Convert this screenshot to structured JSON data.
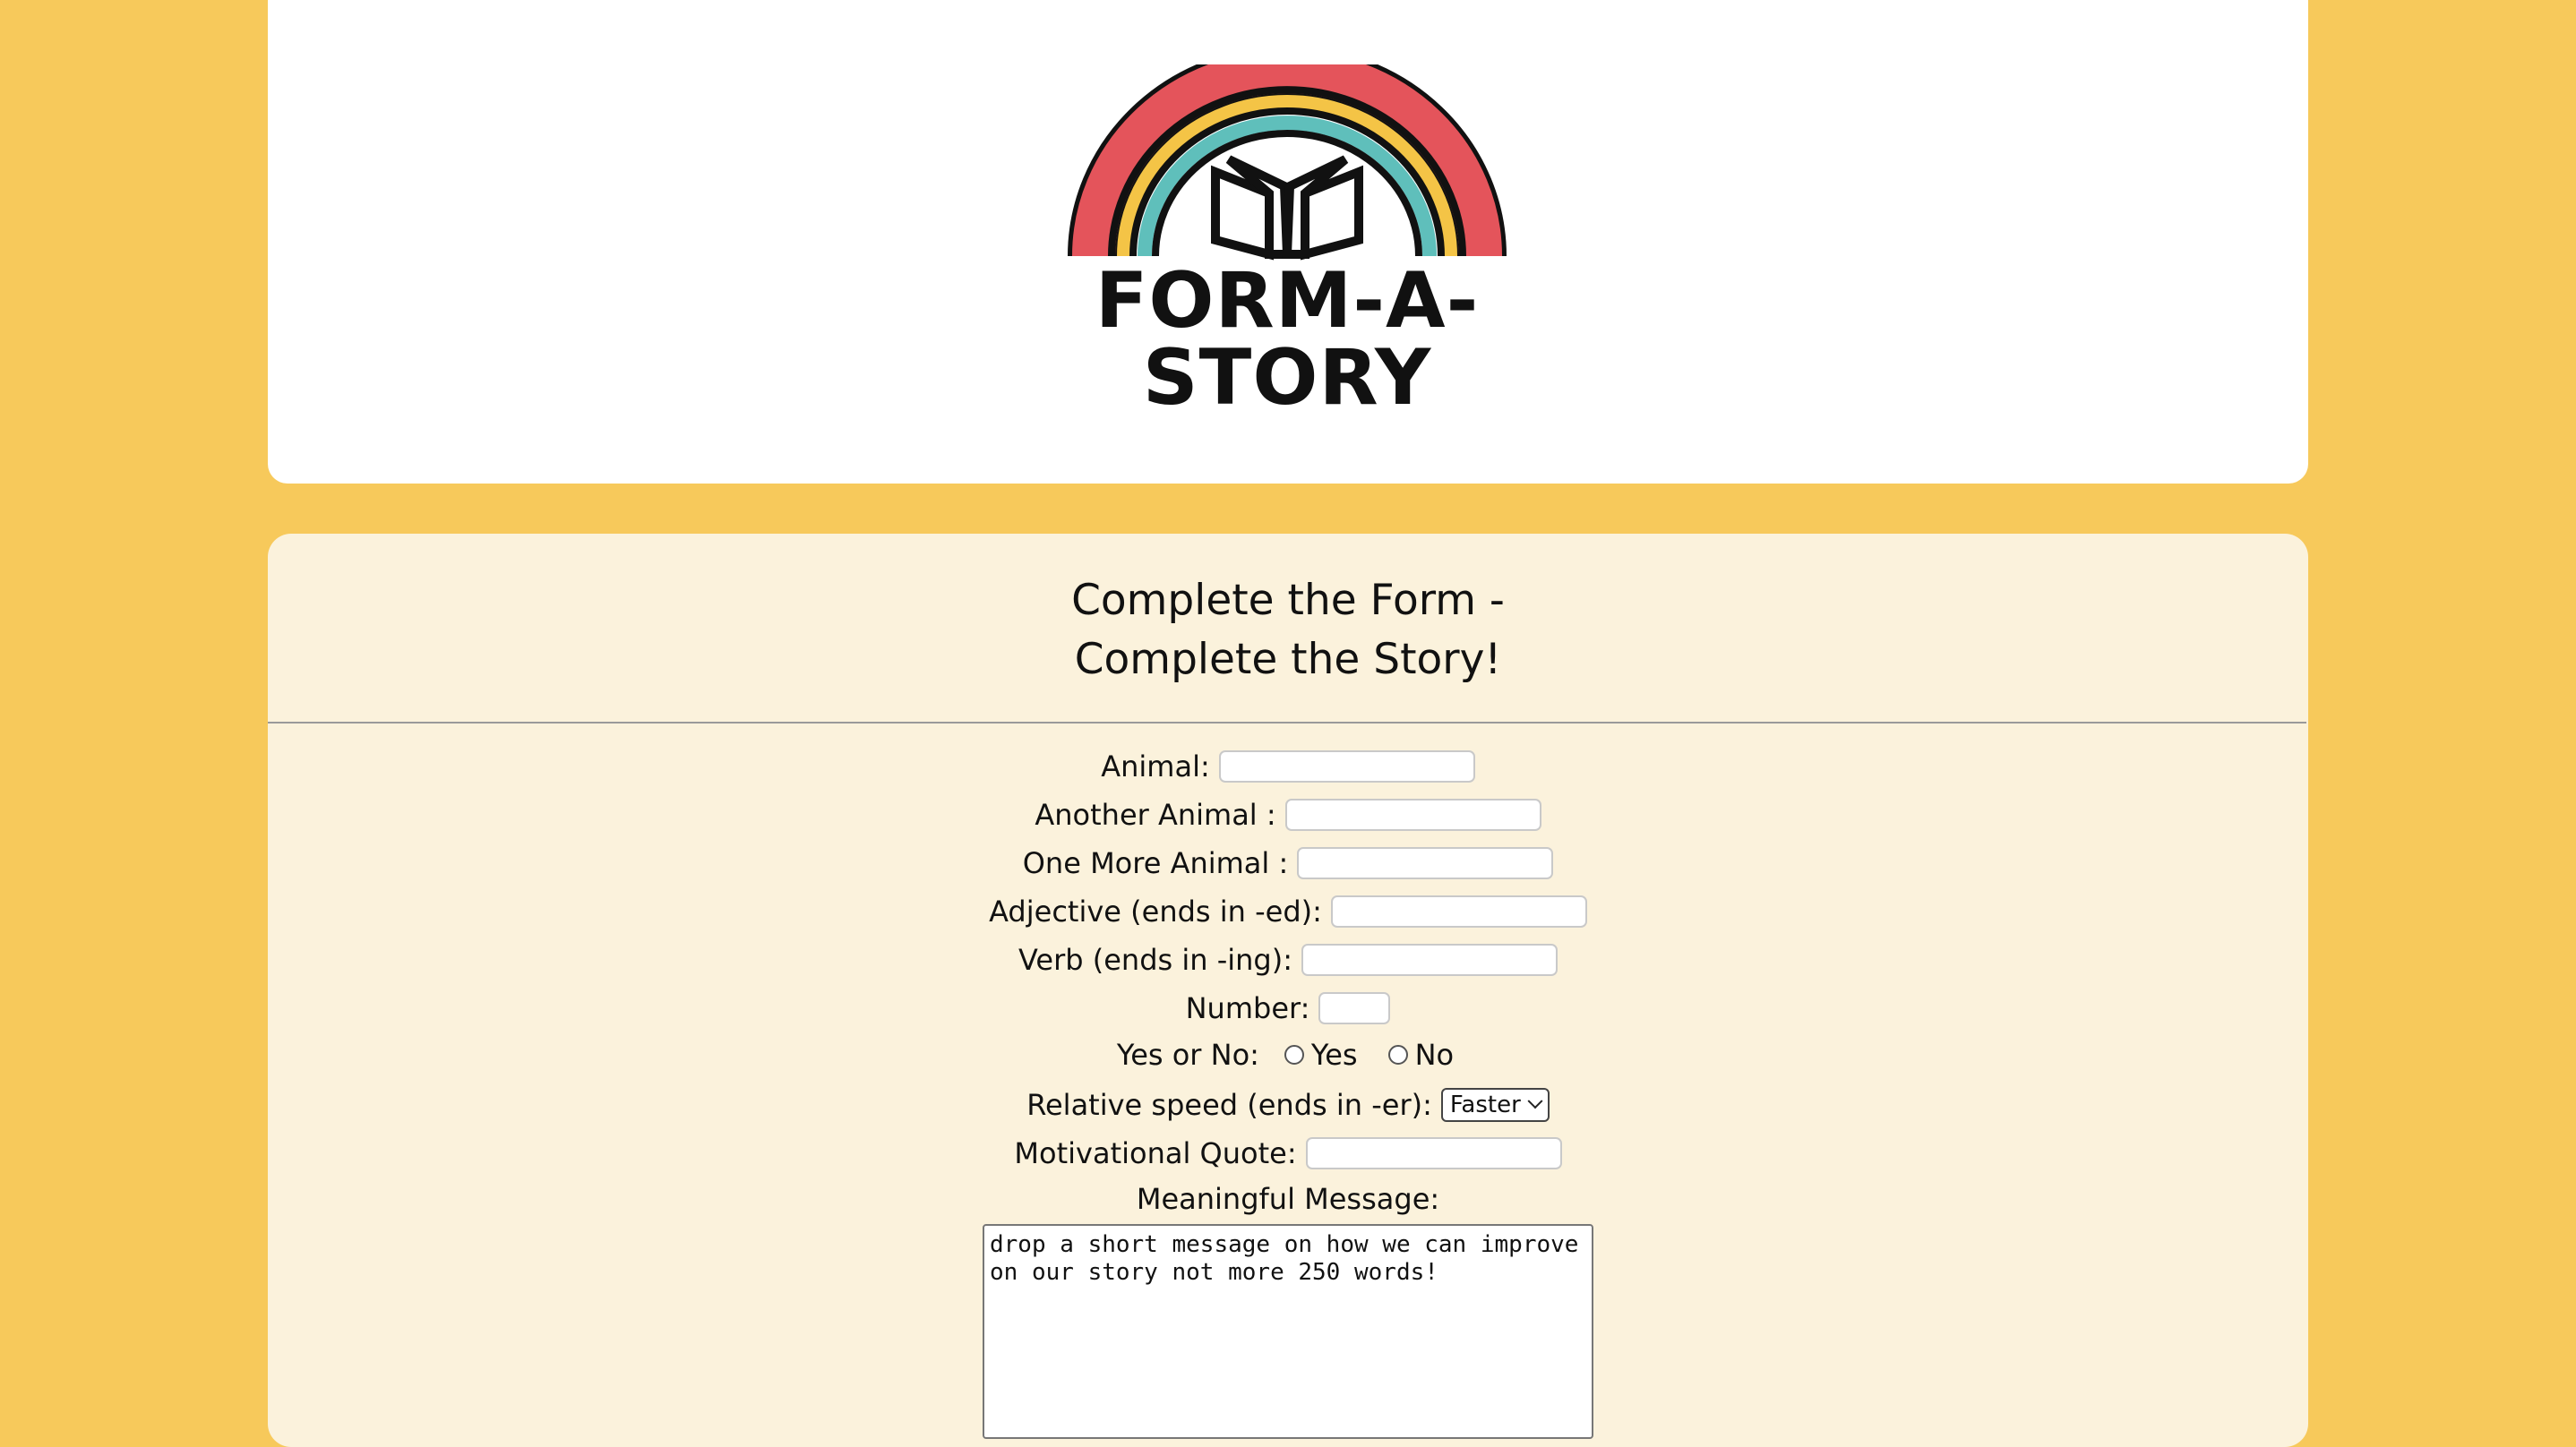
{
  "logo": {
    "text": "FORM-A-STORY",
    "icon": "rainbow-book-icon",
    "colors": {
      "outer": "#e4545b",
      "middle": "#f4c446",
      "inner": "#5fbfbb",
      "outline": "#111111"
    }
  },
  "form": {
    "title_line1": "Complete the Form -",
    "title_line2": "Complete the Story!",
    "fields": {
      "animal": {
        "label": "Animal:",
        "value": ""
      },
      "another_animal": {
        "label": "Another Animal :",
        "value": ""
      },
      "one_more_animal": {
        "label": "One More Animal :",
        "value": ""
      },
      "adjective": {
        "label": "Adjective (ends in -ed):",
        "value": ""
      },
      "verb": {
        "label": "Verb (ends in -ing):",
        "value": ""
      },
      "number": {
        "label": "Number:",
        "value": ""
      },
      "yes_or_no": {
        "label": "Yes or No:",
        "options": [
          "Yes",
          "No"
        ]
      },
      "relative_speed": {
        "label": "Relative speed (ends in -er):",
        "selected": "Faster"
      },
      "motivational_quote": {
        "label": "Motivational Quote:",
        "value": ""
      },
      "meaningful_message": {
        "label": "Meaningful Message:",
        "value": "drop a short message on how we can improve on our story not more 250 words!"
      }
    }
  },
  "colors": {
    "page_background": "#f7c95b",
    "header_card": "#ffffff",
    "form_card": "#fbf2dc"
  }
}
